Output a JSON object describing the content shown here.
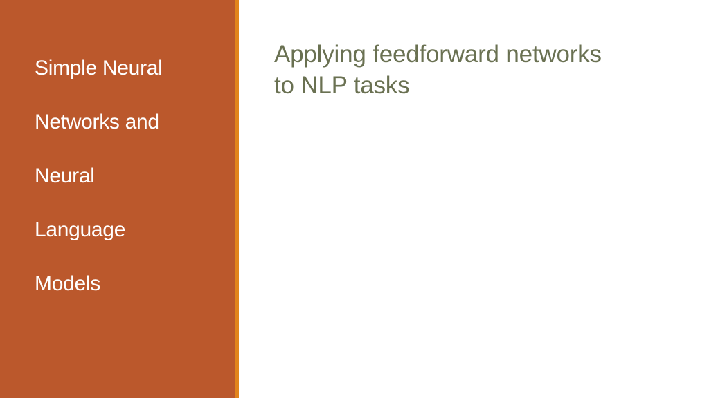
{
  "colors": {
    "left_panel": "#bb582c",
    "accent_stripe": "#e2841c",
    "section_title_text": "#ffffff",
    "slide_title_text": "#6a7152",
    "background": "#ffffff"
  },
  "sidebar": {
    "section_title_lines": [
      "Simple Neural",
      "Networks and",
      "Neural",
      "Language",
      "Models"
    ]
  },
  "main": {
    "title_lines": [
      "Applying feedforward networks",
      "to NLP tasks"
    ]
  }
}
